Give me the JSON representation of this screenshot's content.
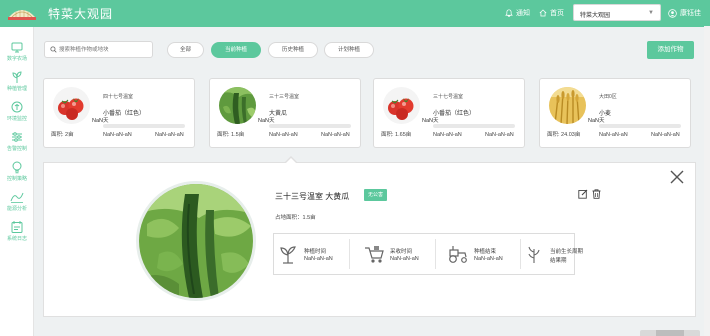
{
  "header": {
    "app_title": "特菜大观园",
    "notify_label": "通知",
    "home_label": "首页",
    "garden_select_value": "特菜大观园",
    "user_name": "康钰佳"
  },
  "sidebar": {
    "items": [
      {
        "label": "数字农场",
        "icon": "farm-icon"
      },
      {
        "label": "种植管理",
        "icon": "planting-icon"
      },
      {
        "label": "环境监控",
        "icon": "environment-icon"
      },
      {
        "label": "告警控制",
        "icon": "alarm-control-icon"
      },
      {
        "label": "控制策略",
        "icon": "strategy-icon"
      },
      {
        "label": "能源分析",
        "icon": "energy-icon"
      },
      {
        "label": "系统日志",
        "icon": "log-icon"
      }
    ]
  },
  "toolbar": {
    "search_placeholder": "搜索种植作物或地块",
    "tabs": [
      {
        "label": "全部"
      },
      {
        "label": "当前种植"
      },
      {
        "label": "历史种植"
      },
      {
        "label": "计划种植"
      }
    ],
    "active_tab_index": 1,
    "add_button_label": "添加作物"
  },
  "cards": [
    {
      "greenhouse": "四十七号温室",
      "crop": "小番茄（红色）",
      "days": "NaN天",
      "area": "面积: 2亩",
      "start_date": "NaN-aN-aN",
      "end_date": "NaN-aN-aN",
      "image": "tomato"
    },
    {
      "greenhouse": "三十三号温室",
      "crop": "大黄瓜",
      "days": "NaN天",
      "area": "面积: 1.5亩",
      "start_date": "NaN-aN-aN",
      "end_date": "NaN-aN-aN",
      "image": "cucumber"
    },
    {
      "greenhouse": "三十七号温室",
      "crop": "小番茄（红色）",
      "days": "NaN天",
      "area": "面积: 1.65亩",
      "start_date": "NaN-aN-aN",
      "end_date": "NaN-aN-aN",
      "image": "tomato"
    },
    {
      "greenhouse": "大田0区",
      "crop": "小麦",
      "days": "NaN天",
      "area": "面积: 24.03亩",
      "start_date": "NaN-aN-aN",
      "end_date": "NaN-aN-aN",
      "image": "wheat"
    }
  ],
  "detail": {
    "title": "三十三号温室  大黄瓜",
    "badge": "无公害",
    "area": "占地面积：1.5亩",
    "stages": [
      {
        "label": "种植时间",
        "value": "NaN-aN-aN",
        "icon": "sprout-icon"
      },
      {
        "label": "采收时间",
        "value": "NaN-aN-aN",
        "icon": "harvest-cart-icon"
      },
      {
        "label": "种植结束",
        "value": "NaN-aN-aN",
        "icon": "tractor-icon"
      },
      {
        "label": "当前生长周期",
        "value": "结果期",
        "icon": "growth-cycle-icon"
      }
    ]
  },
  "colors": {
    "accent": "#5cc89d",
    "background": "#eef1f2"
  }
}
